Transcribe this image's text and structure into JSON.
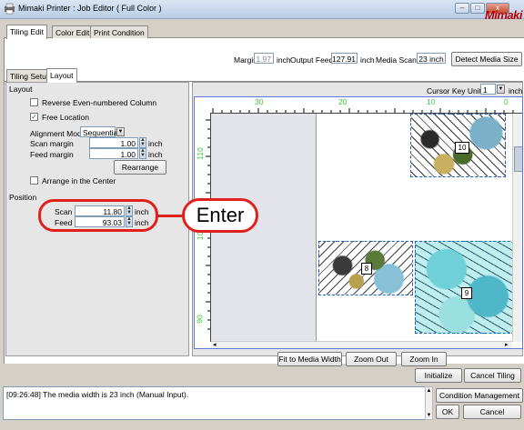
{
  "window": {
    "title": "Mimaki Printer : Job Editor ( Full Color )",
    "logo": "Mimaki",
    "minimize": "–",
    "maximize": "□",
    "close": "x"
  },
  "main_tabs": [
    {
      "label": "Tiling Edit",
      "active": true
    },
    {
      "label": "Color Edit",
      "active": false
    },
    {
      "label": "Print Condition",
      "active": false
    }
  ],
  "media_bar": {
    "margin_label": "Margin",
    "margin_value": "1.97",
    "margin_unit": "inch",
    "output_feed_label": "Output Feed",
    "output_feed_value": "127.91",
    "output_feed_unit": "inch",
    "media_scan_label": "Media Scan",
    "media_scan_value": "23 inch",
    "detect_button": "Detect Media Size"
  },
  "sub_tabs": [
    {
      "label": "Tiling Setup",
      "active": false
    },
    {
      "label": "Layout",
      "active": true
    }
  ],
  "layout_panel": {
    "group_label": "Layout",
    "reverse_label": "Reverse Even-numbered Column",
    "reverse_checked": false,
    "free_location_label": "Free Location",
    "free_location_checked": true,
    "alignment_label": "Alignment Mode",
    "alignment_value": "Sequential",
    "scan_margin_label": "Scan margin",
    "scan_margin_value": "1.00",
    "feed_margin_label": "Feed margin",
    "feed_margin_value": "1.00",
    "unit": "inch",
    "rearrange_button": "Rearrange",
    "arrange_center_label": "Arrange in the Center",
    "arrange_center_checked": false
  },
  "position_panel": {
    "group_label": "Position",
    "scan_label": "Scan",
    "scan_value": "11.80",
    "feed_label": "Feed",
    "feed_value": "93.03",
    "unit": "inch"
  },
  "callout": {
    "text": "Enter",
    "color": "#e0201a"
  },
  "preview": {
    "cursor_key_label": "Cursor Key Unit",
    "cursor_key_value": "1",
    "cursor_key_unit": "inch",
    "ruler_top_labels": [
      "30",
      "20",
      "10",
      "0"
    ],
    "ruler_left_labels": [
      "110",
      "100",
      "90"
    ],
    "tiles": [
      {
        "label": "10"
      },
      {
        "label": "8"
      },
      {
        "label": "9"
      }
    ],
    "fit_button": "Fit to Media Width",
    "zoom_out_button": "Zoom Out",
    "zoom_in_button": "Zoom In"
  },
  "footer": {
    "initialize_button": "Initialize",
    "cancel_tiling_button": "Cancel Tiling",
    "log_text": "[09:26:48] The media width is 23 inch (Manual Input).",
    "condition_button": "Condition Management",
    "ok_button": "OK",
    "cancel_button": "Cancel"
  }
}
